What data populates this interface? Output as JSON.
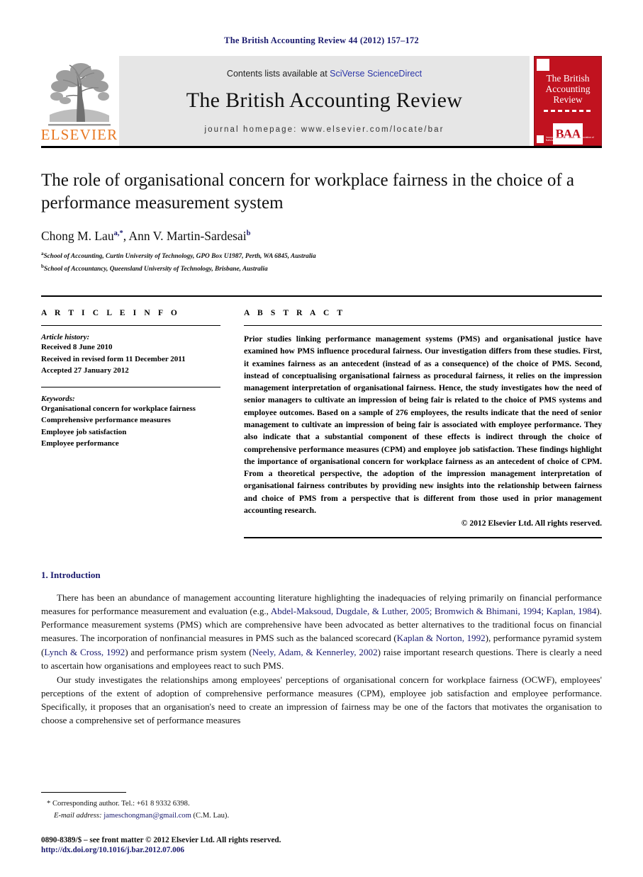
{
  "running_head": "The British Accounting Review 44 (2012) 157–172",
  "masthead": {
    "contents_prefix": "Contents lists available at ",
    "sciencedirect": "SciVerse ScienceDirect",
    "journal_title": "The British Accounting Review",
    "homepage": "journal homepage: www.elsevier.com/locate/bar",
    "publisher_wordmark": "ELSEVIER",
    "cover": {
      "title_line1": "The British",
      "title_line2": "Accounting",
      "title_line3": "Review",
      "association_logo": "BAA",
      "footer_text": "Incorporating the journal of the Association of National Teaching Fellows",
      "color": "#c1121f"
    }
  },
  "article": {
    "title": "The role of organisational concern for workplace fairness in the choice of a performance measurement system",
    "authors": "Chong M. Lau",
    "author_sup_1": "a,*",
    "authors_2": ", Ann V. Martin-Sardesai",
    "author_sup_2": "b",
    "affiliation_a_sup": "a",
    "affiliation_a": "School of Accounting, Curtin University of Technology, GPO Box U1987, Perth, WA 6845, Australia",
    "affiliation_b_sup": "b",
    "affiliation_b": "School of Accountancy, Queensland University of Technology, Brisbane, Australia"
  },
  "info": {
    "heading": "A R T I C L E  I N F O",
    "history_label": "Article history:",
    "history": [
      "Received 8 June 2010",
      "Received in revised form 11 December 2011",
      "Accepted 27 January 2012"
    ],
    "keywords_label": "Keywords:",
    "keywords": [
      "Organisational concern for workplace fairness",
      "Comprehensive performance measures",
      "Employee job satisfaction",
      "Employee performance"
    ]
  },
  "abstract": {
    "heading": "A B S T R A C T",
    "text": "Prior studies linking performance management systems (PMS) and organisational justice have examined how PMS influence procedural fairness. Our investigation differs from these studies. First, it examines fairness as an antecedent (instead of as a consequence) of the choice of PMS. Second, instead of conceptualising organisational fairness as procedural fairness, it relies on the impression management interpretation of organisational fairness. Hence, the study investigates how the need of senior managers to cultivate an impression of being fair is related to the choice of PMS systems and employee outcomes. Based on a sample of 276 employees, the results indicate that the need of senior management to cultivate an impression of being fair is associated with employee performance. They also indicate that a substantial component of these effects is indirect through the choice of comprehensive performance measures (CPM) and employee job satisfaction. These findings highlight the importance of organisational concern for workplace fairness as an antecedent of choice of CPM. From a theoretical perspective, the adoption of the impression management interpretation of organisational fairness contributes by providing new insights into the relationship between fairness and choice of PMS from a perspective that is different from those used in prior management accounting research.",
    "copyright": "© 2012 Elsevier Ltd. All rights reserved."
  },
  "body": {
    "section_heading": "1. Introduction",
    "para1_a": "There has been an abundance of management accounting literature highlighting the inadequacies of relying primarily on financial performance measures for performance measurement and evaluation (e.g., ",
    "para1_cite1": "Abdel-Maksoud, Dugdale, & Luther, 2005; Bromwich & Bhimani, 1994; Kaplan, 1984",
    "para1_b": "). Performance measurement systems (PMS) which are comprehensive have been advocated as better alternatives to the traditional focus on financial measures. The incorporation of nonfinancial measures in PMS such as the balanced scorecard (",
    "para1_cite2": "Kaplan & Norton, 1992",
    "para1_c": "), performance pyramid system (",
    "para1_cite3": "Lynch & Cross, 1992",
    "para1_d": ") and performance prism system (",
    "para1_cite4": "Neely, Adam, & Kennerley, 2002",
    "para1_e": ") raise important research questions. There is clearly a need to ascertain how organisations and employees react to such PMS.",
    "para2": "Our study investigates the relationships among employees' perceptions of organisational concern for workplace fairness (OCWF), employees' perceptions of the extent of adoption of comprehensive performance measures (CPM), employee job satisfaction and employee performance. Specifically, it proposes that an organisation's need to create an impression of fairness may be one of the factors that motivates the organisation to choose a comprehensive set of performance measures"
  },
  "footnotes": {
    "corresponding_marker": "*",
    "corresponding": "Corresponding author. Tel.: +61 8 9332 6398.",
    "email_label": "E-mail address:",
    "email": "jameschongman@gmail.com",
    "email_owner": "(C.M. Lau)."
  },
  "footer": {
    "issn_line": "0890-8389/$ – see front matter © 2012 Elsevier Ltd. All rights reserved.",
    "doi": "http://dx.doi.org/10.1016/j.bar.2012.07.006"
  }
}
